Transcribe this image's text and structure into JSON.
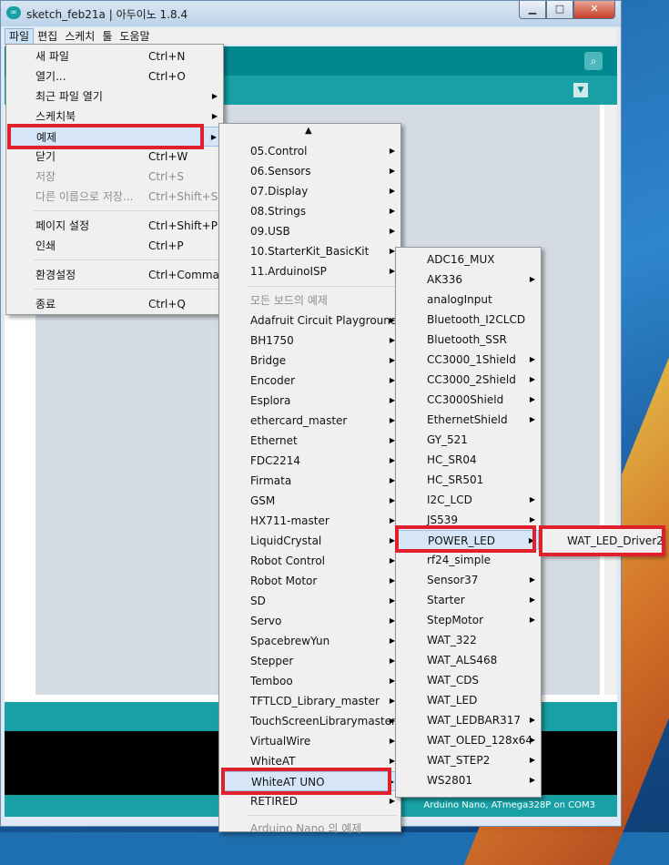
{
  "window": {
    "title": "sketch_feb21a | 아두이노 1.8.4",
    "app_icon": "arduino-infinity-icon",
    "buttons": {
      "minimize": "▁",
      "maximize": "□",
      "close": "✕"
    }
  },
  "menubar": [
    "파일",
    "편집",
    "스케치",
    "툴",
    "도움말"
  ],
  "status": "Arduino Nano, ATmega328P on COM3",
  "file_menu": {
    "items": [
      {
        "label": "새 파일",
        "shortcut": "Ctrl+N"
      },
      {
        "label": "열기...",
        "shortcut": "Ctrl+O"
      },
      {
        "label": "최근 파일 열기",
        "shortcut": ""
      },
      {
        "label": "스케치북",
        "shortcut": ""
      },
      {
        "label": "예제",
        "shortcut": ""
      },
      {
        "label": "닫기",
        "shortcut": "Ctrl+W"
      },
      {
        "label": "저장",
        "shortcut": "Ctrl+S"
      },
      {
        "label": "다른 이름으로 저장...",
        "shortcut": "Ctrl+Shift+S"
      },
      {
        "label": "페이지 설정",
        "shortcut": "Ctrl+Shift+P"
      },
      {
        "label": "인쇄",
        "shortcut": "Ctrl+P"
      },
      {
        "label": "환경설정",
        "shortcut": "Ctrl+Comma"
      },
      {
        "label": "종료",
        "shortcut": "Ctrl+Q"
      }
    ]
  },
  "examples_menu": {
    "scroll_up": "▲",
    "items": [
      "05.Control",
      "06.Sensors",
      "07.Display",
      "08.Strings",
      "09.USB",
      "10.StarterKit_BasicKit",
      "11.ArduinoISP"
    ],
    "section_header": "모든 보드의 예제",
    "board_items": [
      "Adafruit Circuit Playground",
      "BH1750",
      "Bridge",
      "Encoder",
      "Esplora",
      "ethercard_master",
      "Ethernet",
      "FDC2214",
      "Firmata",
      "GSM",
      "HX711-master",
      "LiquidCrystal",
      "Robot Control",
      "Robot Motor",
      "SD",
      "Servo",
      "SpacebrewYun",
      "Stepper",
      "Temboo",
      "TFTLCD_Library_master",
      "TouchScreenLibrarymaster",
      "VirtualWire",
      "WhiteAT",
      "WhiteAT UNO",
      "RETIRED"
    ],
    "footer_header": "Arduino Nano 의 예제"
  },
  "whiteat_uno_menu": {
    "items": [
      "ADC16_MUX",
      "AK336",
      "analogInput",
      "Bluetooth_I2CLCD",
      "Bluetooth_SSR",
      "CC3000_1Shield",
      "CC3000_2Shield",
      "CC3000Shield",
      "EthernetShield",
      "GY_521",
      "HC_SR04",
      "HC_SR501",
      "I2C_LCD",
      "JS539",
      "POWER_LED",
      "rf24_simple",
      "Sensor37",
      "Starter",
      "StepMotor",
      "WAT_322",
      "WAT_ALS468",
      "WAT_CDS",
      "WAT_LED",
      "WAT_LEDBAR317",
      "WAT_OLED_128x64",
      "WAT_STEP2",
      "WS2801"
    ]
  },
  "power_led_menu": {
    "items": [
      "WAT_LED_Driver2"
    ]
  }
}
